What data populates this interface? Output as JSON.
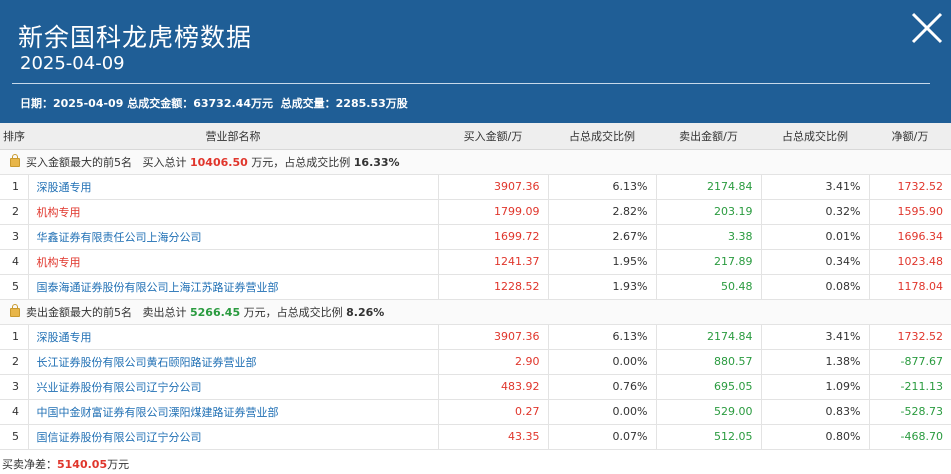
{
  "header": {
    "title": "新余国科龙虎榜数据",
    "date": "2025-04-09",
    "summary_date_label": "日期：",
    "summary_date": "2025-04-09",
    "summary_amount_label": "总成交金额：",
    "summary_amount": "63732.44万元",
    "summary_volume_label": "总成交量：",
    "summary_volume": "2285.53万股"
  },
  "columns": [
    "排序",
    "营业部名称",
    "买入金额/万",
    "占总成交比例",
    "卖出金额/万",
    "占总成交比例",
    "净额/万"
  ],
  "buy_section": {
    "label": "买入金额最大的前5名",
    "total_label": "买入总计",
    "total_value": "10406.50",
    "total_unit": "万元，占总成交比例",
    "ratio": "16.33%"
  },
  "buy_rows": [
    {
      "rank": "1",
      "name": "深股通专用",
      "name_color": "blue",
      "buy": "3907.36",
      "buy_ratio": "6.13%",
      "sell": "2174.84",
      "sell_ratio": "3.41%",
      "net": "1732.52",
      "net_color": "red"
    },
    {
      "rank": "2",
      "name": "机构专用",
      "name_color": "red",
      "buy": "1799.09",
      "buy_ratio": "2.82%",
      "sell": "203.19",
      "sell_ratio": "0.32%",
      "net": "1595.90",
      "net_color": "red"
    },
    {
      "rank": "3",
      "name": "华鑫证券有限责任公司上海分公司",
      "name_color": "blue",
      "buy": "1699.72",
      "buy_ratio": "2.67%",
      "sell": "3.38",
      "sell_ratio": "0.01%",
      "net": "1696.34",
      "net_color": "red"
    },
    {
      "rank": "4",
      "name": "机构专用",
      "name_color": "red",
      "buy": "1241.37",
      "buy_ratio": "1.95%",
      "sell": "217.89",
      "sell_ratio": "0.34%",
      "net": "1023.48",
      "net_color": "red"
    },
    {
      "rank": "5",
      "name": "国泰海通证券股份有限公司上海江苏路证券营业部",
      "name_color": "blue",
      "buy": "1228.52",
      "buy_ratio": "1.93%",
      "sell": "50.48",
      "sell_ratio": "0.08%",
      "net": "1178.04",
      "net_color": "red"
    }
  ],
  "sell_section": {
    "label": "卖出金额最大的前5名",
    "total_label": "卖出总计",
    "total_value": "5266.45",
    "total_unit": "万元，占总成交比例",
    "ratio": "8.26%"
  },
  "sell_rows": [
    {
      "rank": "1",
      "name": "深股通专用",
      "name_color": "blue",
      "buy": "3907.36",
      "buy_ratio": "6.13%",
      "sell": "2174.84",
      "sell_ratio": "3.41%",
      "net": "1732.52",
      "net_color": "red"
    },
    {
      "rank": "2",
      "name": "长江证券股份有限公司黄石颐阳路证券营业部",
      "name_color": "blue",
      "buy": "2.90",
      "buy_ratio": "0.00%",
      "sell": "880.57",
      "sell_ratio": "1.38%",
      "net": "-877.67",
      "net_color": "green"
    },
    {
      "rank": "3",
      "name": "兴业证券股份有限公司辽宁分公司",
      "name_color": "blue",
      "buy": "483.92",
      "buy_ratio": "0.76%",
      "sell": "695.05",
      "sell_ratio": "1.09%",
      "net": "-211.13",
      "net_color": "green"
    },
    {
      "rank": "4",
      "name": "中国中金财富证券有限公司溧阳煤建路证券营业部",
      "name_color": "blue",
      "buy": "0.27",
      "buy_ratio": "0.00%",
      "sell": "529.00",
      "sell_ratio": "0.83%",
      "net": "-528.73",
      "net_color": "green"
    },
    {
      "rank": "5",
      "name": "国信证券股份有限公司辽宁分公司",
      "name_color": "blue",
      "buy": "43.35",
      "buy_ratio": "0.07%",
      "sell": "512.05",
      "sell_ratio": "0.80%",
      "net": "-468.70",
      "net_color": "green"
    }
  ],
  "footer": {
    "label": "买卖净差：",
    "value": "5140.05",
    "unit": "万元"
  },
  "colors": {
    "header_bg": "#1f5e96",
    "red": "#e0362c",
    "green": "#2a9b3f",
    "blue": "#1f6fb4"
  },
  "icons": {
    "close": "close-icon",
    "section": "lock-icon"
  }
}
